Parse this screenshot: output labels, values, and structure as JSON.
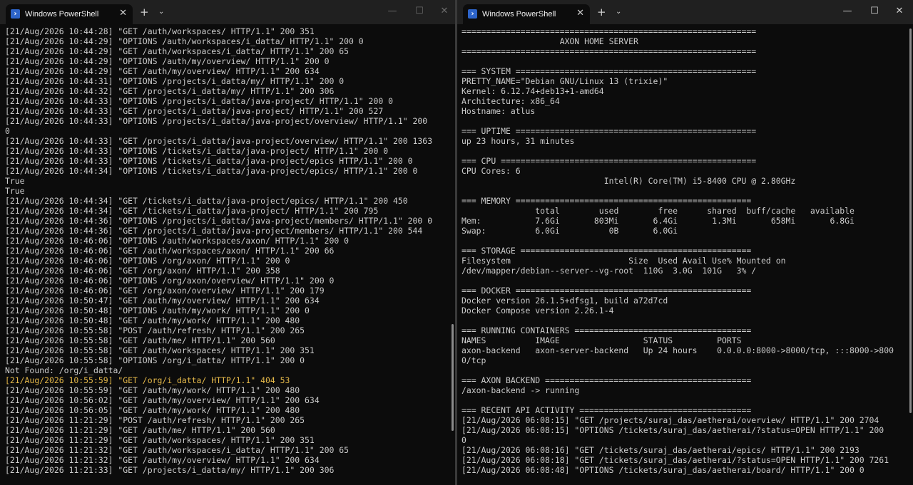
{
  "left": {
    "tab_title": "Windows PowerShell",
    "tab_icon": "powershell-icon",
    "lines": [
      "[21/Aug/2026 10:44:28] \"GET /auth/workspaces/ HTTP/1.1\" 200 351",
      "[21/Aug/2026 10:44:29] \"OPTIONS /auth/workspaces/i_datta/ HTTP/1.1\" 200 0",
      "[21/Aug/2026 10:44:29] \"GET /auth/workspaces/i_datta/ HTTP/1.1\" 200 65",
      "[21/Aug/2026 10:44:29] \"OPTIONS /auth/my/overview/ HTTP/1.1\" 200 0",
      "[21/Aug/2026 10:44:29] \"GET /auth/my/overview/ HTTP/1.1\" 200 634",
      "[21/Aug/2026 10:44:31] \"OPTIONS /projects/i_datta/my/ HTTP/1.1\" 200 0",
      "[21/Aug/2026 10:44:32] \"GET /projects/i_datta/my/ HTTP/1.1\" 200 306",
      "[21/Aug/2026 10:44:33] \"OPTIONS /projects/i_datta/java-project/ HTTP/1.1\" 200 0",
      "[21/Aug/2026 10:44:33] \"GET /projects/i_datta/java-project/ HTTP/1.1\" 200 527",
      "[21/Aug/2026 10:44:33] \"OPTIONS /projects/i_datta/java-project/overview/ HTTP/1.1\" 200",
      "0",
      "[21/Aug/2026 10:44:33] \"GET /projects/i_datta/java-project/overview/ HTTP/1.1\" 200 1363",
      "[21/Aug/2026 10:44:33] \"OPTIONS /tickets/i_datta/java-project/ HTTP/1.1\" 200 0",
      "[21/Aug/2026 10:44:33] \"OPTIONS /tickets/i_datta/java-project/epics HTTP/1.1\" 200 0",
      "[21/Aug/2026 10:44:34] \"OPTIONS /tickets/i_datta/java-project/epics/ HTTP/1.1\" 200 0",
      "True",
      "True",
      "[21/Aug/2026 10:44:34] \"GET /tickets/i_datta/java-project/epics/ HTTP/1.1\" 200 450",
      "[21/Aug/2026 10:44:34] \"GET /tickets/i_datta/java-project/ HTTP/1.1\" 200 795",
      "[21/Aug/2026 10:44:36] \"OPTIONS /projects/i_datta/java-project/members/ HTTP/1.1\" 200 0",
      "[21/Aug/2026 10:44:36] \"GET /projects/i_datta/java-project/members/ HTTP/1.1\" 200 544",
      "[21/Aug/2026 10:46:06] \"OPTIONS /auth/workspaces/axon/ HTTP/1.1\" 200 0",
      "[21/Aug/2026 10:46:06] \"GET /auth/workspaces/axon/ HTTP/1.1\" 200 66",
      "[21/Aug/2026 10:46:06] \"OPTIONS /org/axon/ HTTP/1.1\" 200 0",
      "[21/Aug/2026 10:46:06] \"GET /org/axon/ HTTP/1.1\" 200 358",
      "[21/Aug/2026 10:46:06] \"OPTIONS /org/axon/overview/ HTTP/1.1\" 200 0",
      "[21/Aug/2026 10:46:06] \"GET /org/axon/overview/ HTTP/1.1\" 200 179",
      "[21/Aug/2026 10:50:47] \"GET /auth/my/overview/ HTTP/1.1\" 200 634",
      "[21/Aug/2026 10:50:48] \"OPTIONS /auth/my/work/ HTTP/1.1\" 200 0",
      "[21/Aug/2026 10:50:48] \"GET /auth/my/work/ HTTP/1.1\" 200 480",
      "[21/Aug/2026 10:55:58] \"POST /auth/refresh/ HTTP/1.1\" 200 265",
      "[21/Aug/2026 10:55:58] \"GET /auth/me/ HTTP/1.1\" 200 560",
      "[21/Aug/2026 10:55:58] \"GET /auth/workspaces/ HTTP/1.1\" 200 351",
      "[21/Aug/2026 10:55:58] \"OPTIONS /org/i_datta/ HTTP/1.1\" 200 0",
      "Not Found: /org/i_datta/",
      "[21/Aug/2026 10:55:59] \"GET /org/i_datta/ HTTP/1.1\" 404 53",
      "[21/Aug/2026 10:55:59] \"GET /auth/my/work/ HTTP/1.1\" 200 480",
      "[21/Aug/2026 10:56:02] \"GET /auth/my/overview/ HTTP/1.1\" 200 634",
      "[21/Aug/2026 10:56:05] \"GET /auth/my/work/ HTTP/1.1\" 200 480",
      "[21/Aug/2026 11:21:29] \"POST /auth/refresh/ HTTP/1.1\" 200 265",
      "[21/Aug/2026 11:21:29] \"GET /auth/me/ HTTP/1.1\" 200 560",
      "[21/Aug/2026 11:21:29] \"GET /auth/workspaces/ HTTP/1.1\" 200 351",
      "[21/Aug/2026 11:21:32] \"GET /auth/workspaces/i_datta/ HTTP/1.1\" 200 65",
      "[21/Aug/2026 11:21:32] \"GET /auth/my/overview/ HTTP/1.1\" 200 634",
      "[21/Aug/2026 11:21:33] \"GET /projects/i_datta/my/ HTTP/1.1\" 200 306"
    ],
    "warn_line": "[21/Aug/2026 10:55:59] \"GET /org/i_datta/ HTTP/1.1\" 404 53"
  },
  "right": {
    "tab_title": "Windows PowerShell",
    "tab_icon": "powershell-icon",
    "lines": [
      "============================================================",
      "                    AXON HOME SERVER",
      "============================================================",
      "",
      "=== SYSTEM =================================================",
      "PRETTY_NAME=\"Debian GNU/Linux 13 (trixie)\"",
      "Kernel: 6.12.74+deb13+1-amd64",
      "Architecture: x86_64",
      "Hostname: atlus",
      "",
      "=== UPTIME =================================================",
      "up 23 hours, 31 minutes",
      "",
      "=== CPU ====================================================",
      "CPU Cores: 6",
      "                             Intel(R) Core(TM) i5-8400 CPU @ 2.80GHz",
      "",
      "=== MEMORY ================================================",
      "               total        used        free      shared  buff/cache   available",
      "Mem:           7.6Gi       803Mi       6.4Gi       1.3Mi       658Mi       6.8Gi",
      "Swap:          6.0Gi          0B       6.0Gi",
      "",
      "=== STORAGE ===============================================",
      "Filesystem                        Size  Used Avail Use% Mounted on",
      "/dev/mapper/debian--server--vg-root  110G  3.0G  101G   3% /",
      "",
      "=== DOCKER ================================================",
      "Docker version 26.1.5+dfsg1, build a72d7cd",
      "Docker Compose version 2.26.1-4",
      "",
      "=== RUNNING CONTAINERS ====================================",
      "NAMES          IMAGE                 STATUS         PORTS",
      "axon-backend   axon-server-backend   Up 24 hours    0.0.0.0:8000->8000/tcp, :::8000->800",
      "0/tcp",
      "",
      "=== AXON BACKEND ==========================================",
      "/axon-backend -> running",
      "",
      "=== RECENT API ACTIVITY ===================================",
      "[21/Aug/2026 06:08:15] \"GET /projects/suraj_das/aetherai/overview/ HTTP/1.1\" 200 2704",
      "[21/Aug/2026 06:08:15] \"OPTIONS /tickets/suraj_das/aetherai/?status=OPEN HTTP/1.1\" 200",
      "0",
      "[21/Aug/2026 06:08:16] \"GET /tickets/suraj_das/aetherai/epics/ HTTP/1.1\" 200 2193",
      "[21/Aug/2026 06:08:18] \"GET /tickets/suraj_das/aetherai/?status=OPEN HTTP/1.1\" 200 7261",
      "[21/Aug/2026 06:08:48] \"OPTIONS /tickets/suraj_das/aetherai/board/ HTTP/1.1\" 200 0"
    ]
  },
  "controls": {
    "close_tab": "✕",
    "new_tab": "+",
    "dropdown": "⌄",
    "minimize": "—",
    "maximize": "☐",
    "close_window": "✕"
  },
  "colors": {
    "background": "#0c0c0c",
    "text": "#cccccc",
    "warning_text": "#e5b94a",
    "titlebar": "#202020"
  }
}
